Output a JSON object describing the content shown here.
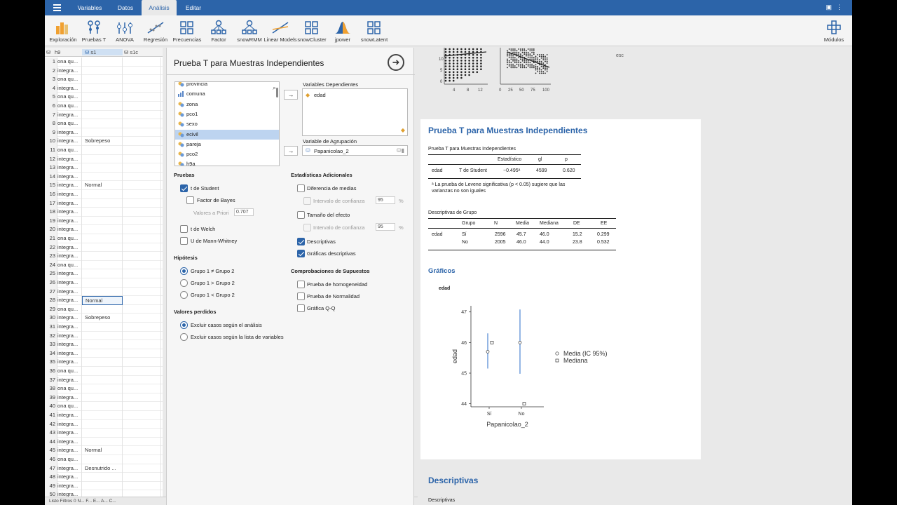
{
  "menubar": {
    "tabs": [
      "Variables",
      "Datos",
      "Análisis",
      "Editar"
    ],
    "active_tab": "Análisis"
  },
  "ribbon": {
    "buttons": [
      "Exploración",
      "Pruebas T",
      "ANOVA",
      "Regresión",
      "Frecuencias",
      "Factor",
      "snowRMM",
      "Linear Models",
      "snowCluster",
      "jpower",
      "snowLatent"
    ],
    "modules": "Módulos"
  },
  "datagrid": {
    "columns": [
      "h9",
      "s1",
      "s1c"
    ],
    "rows": [
      {
        "n": "1",
        "a": "ona qu...",
        "b": ""
      },
      {
        "n": "2",
        "a": "integra...",
        "b": ""
      },
      {
        "n": "3",
        "a": "ona qu...",
        "b": ""
      },
      {
        "n": "4",
        "a": "integra...",
        "b": ""
      },
      {
        "n": "5",
        "a": "ona qu...",
        "b": ""
      },
      {
        "n": "6",
        "a": "ona qu...",
        "b": ""
      },
      {
        "n": "7",
        "a": "integra...",
        "b": ""
      },
      {
        "n": "8",
        "a": "ona qu...",
        "b": ""
      },
      {
        "n": "9",
        "a": "integra...",
        "b": ""
      },
      {
        "n": "10",
        "a": "integra...",
        "b": "Sobrepeso"
      },
      {
        "n": "11",
        "a": "ona qu...",
        "b": ""
      },
      {
        "n": "12",
        "a": "integra...",
        "b": ""
      },
      {
        "n": "13",
        "a": "integra...",
        "b": ""
      },
      {
        "n": "14",
        "a": "integra...",
        "b": ""
      },
      {
        "n": "15",
        "a": "integra...",
        "b": "Normal"
      },
      {
        "n": "16",
        "a": "integra...",
        "b": ""
      },
      {
        "n": "17",
        "a": "integra...",
        "b": ""
      },
      {
        "n": "18",
        "a": "integra...",
        "b": ""
      },
      {
        "n": "19",
        "a": "integra...",
        "b": ""
      },
      {
        "n": "20",
        "a": "integra...",
        "b": ""
      },
      {
        "n": "21",
        "a": "ona qu...",
        "b": ""
      },
      {
        "n": "22",
        "a": "integra...",
        "b": ""
      },
      {
        "n": "23",
        "a": "integra...",
        "b": ""
      },
      {
        "n": "24",
        "a": "ona qu...",
        "b": ""
      },
      {
        "n": "25",
        "a": "integra...",
        "b": ""
      },
      {
        "n": "26",
        "a": "integra...",
        "b": ""
      },
      {
        "n": "27",
        "a": "integra...",
        "b": ""
      },
      {
        "n": "28",
        "a": "integra...",
        "b": "Normal"
      },
      {
        "n": "29",
        "a": "ona qu...",
        "b": ""
      },
      {
        "n": "30",
        "a": "integra...",
        "b": "Sobrepeso"
      },
      {
        "n": "31",
        "a": "integra...",
        "b": ""
      },
      {
        "n": "32",
        "a": "integra...",
        "b": ""
      },
      {
        "n": "33",
        "a": "integra...",
        "b": ""
      },
      {
        "n": "34",
        "a": "integra...",
        "b": ""
      },
      {
        "n": "35",
        "a": "integra...",
        "b": ""
      },
      {
        "n": "36",
        "a": "ona qu...",
        "b": ""
      },
      {
        "n": "37",
        "a": "integra...",
        "b": ""
      },
      {
        "n": "38",
        "a": "ona qu...",
        "b": ""
      },
      {
        "n": "39",
        "a": "integra...",
        "b": ""
      },
      {
        "n": "40",
        "a": "ona qu...",
        "b": ""
      },
      {
        "n": "41",
        "a": "integra...",
        "b": ""
      },
      {
        "n": "42",
        "a": "integra...",
        "b": ""
      },
      {
        "n": "43",
        "a": "integra...",
        "b": ""
      },
      {
        "n": "44",
        "a": "integra...",
        "b": ""
      },
      {
        "n": "45",
        "a": "integra...",
        "b": "Normal"
      },
      {
        "n": "46",
        "a": "ona qu...",
        "b": ""
      },
      {
        "n": "47",
        "a": "integra...",
        "b": "Desnutrido ..."
      },
      {
        "n": "48",
        "a": "integra...",
        "b": ""
      },
      {
        "n": "49",
        "a": "integra...",
        "b": ""
      },
      {
        "n": "50",
        "a": "integra...",
        "b": ""
      }
    ]
  },
  "statusbar": "Listo      Filtros 0      N...   F...   E...   A...   C...",
  "analysis": {
    "title": "Prueba T para Muestras Independientes",
    "varlist": [
      "provincia",
      "comuna",
      "zona",
      "pco1",
      "sexo",
      "ecivil",
      "pareja",
      "pco2",
      "h9a"
    ],
    "dep_label": "Variables Dependientes",
    "dep_value": "edad",
    "group_label": "Variable de Agrupación",
    "group_value": "Papanicolao_2",
    "tests_label": "Pruebas",
    "student": "t de Student",
    "bayes": "Factor de Bayes",
    "prior_label": "Valores a Priori",
    "prior_value": "0.707",
    "welch": "t de Welch",
    "mann": "U de Mann-Whitney",
    "hyp_label": "Hipótesis",
    "h1": "Grupo 1 ≠ Grupo 2",
    "h2": "Grupo 1 > Grupo 2",
    "h3": "Grupo 1 < Grupo 2",
    "missing_label": "Valores perdidos",
    "m1": "Excluir casos según el análisis",
    "m2": "Excluir casos según la lista de variables",
    "extra_label": "Estadísticas Adicionales",
    "meandiff": "Diferencia de medias",
    "ci": "Intervalo de confianza",
    "ci_value": "95",
    "pct": "%",
    "effect": "Tamaño del efecto",
    "desc": "Descriptivas",
    "descplot": "Gráficas descriptivas",
    "assump_label": "Comprobaciones de Supuestos",
    "homog": "Prueba de homogeneidad",
    "normal": "Prueba de Normalidad",
    "qq": "Gráfica Q-Q"
  },
  "results": {
    "esc": "esc",
    "scatter_axes": {
      "y_ticks": [
        "10",
        "5",
        "0"
      ],
      "x1_ticks": [
        "4",
        "8",
        "12"
      ],
      "x2_ticks": [
        "0",
        "25",
        "50",
        "75",
        "100"
      ]
    },
    "main_title": "Prueba T para Muestras Independientes",
    "ttest": {
      "caption": "Prueba T para Muestras Independientes",
      "headers": [
        "Estadístico",
        "gl",
        "p"
      ],
      "row": {
        "var": "edad",
        "test": "T de Student",
        "stat": "−0.495",
        "sup": "ᵃ",
        "df": "4599",
        "p": "0.620"
      },
      "note": "ᵃ La prueba de Levene significativa (p < 0.05) sugiere que las varianzas no son iguales"
    },
    "desc_group": {
      "caption": "Descriptivas de Grupo",
      "headers": [
        "Grupo",
        "N",
        "Media",
        "Mediana",
        "DE",
        "EE"
      ],
      "var": "edad",
      "rows": [
        [
          "Sí",
          "2596",
          "45.7",
          "46.0",
          "15.2",
          "0.299"
        ],
        [
          "No",
          "2005",
          "46.0",
          "44.0",
          "23.8",
          "0.532"
        ]
      ]
    },
    "plots_title": "Gráficos",
    "plot_var": "edad",
    "legend_mean": "Media (IC 95%)",
    "legend_median": "Mediana",
    "desc_title": "Descriptivas",
    "desc_caption": "Descriptivas"
  },
  "chart_data": {
    "type": "scatter",
    "title": "edad",
    "xlabel": "Papanicolao_2",
    "ylabel": "edad",
    "categories": [
      "Sí",
      "No"
    ],
    "ylim": [
      43.9,
      47.2
    ],
    "y_ticks": [
      44,
      45,
      46,
      47
    ],
    "series": [
      {
        "name": "Media (IC 95%)",
        "values": [
          45.7,
          46.0
        ],
        "ci_low": [
          45.15,
          44.98
        ],
        "ci_high": [
          46.3,
          47.08
        ]
      },
      {
        "name": "Mediana",
        "values": [
          46.0,
          44.0
        ]
      }
    ]
  }
}
